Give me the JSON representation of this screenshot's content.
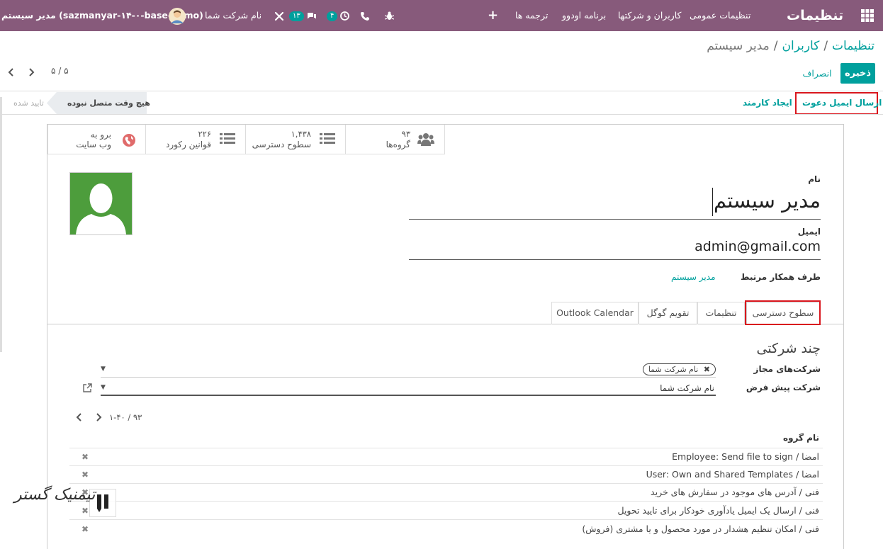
{
  "navbar": {
    "brand": "تنظیمات",
    "menu": [
      "تنظیمات عمومی",
      "کاربران و شرکتها",
      "برنامه اودوو",
      "ترجمه ها"
    ],
    "company": "نام شرکت شما",
    "chat_count": "۱۳",
    "activity_count": "۴",
    "user": "مدیر سیستم (sazmanyar-۱۴-۰-base-demo)"
  },
  "breadcrumb": {
    "root": "تنظیمات",
    "users": "کاربران",
    "current": "مدیر سیستم",
    "sep": "/"
  },
  "actions": {
    "save": "ذخیره",
    "discard": "انصراف"
  },
  "pager": {
    "value": "۵ / ۵"
  },
  "header": {
    "invite_button": "ارسال ایمیل دعوت",
    "create_employee_button": "ایجاد کارمند",
    "stage_never": "هیچ وقت متصل نبوده",
    "stage_confirmed": "تایید شده"
  },
  "smart_buttons": {
    "groups": {
      "count": "۹۳",
      "label": "گروه‌ها"
    },
    "access": {
      "count": "۱,۴۳۸",
      "label": "سطوح دسترسی"
    },
    "rules": {
      "count": "۲۲۶",
      "label": "قوانین رکورد"
    },
    "website": {
      "line1": "برو به",
      "line2": "وب سایت"
    }
  },
  "form": {
    "name_label": "نام",
    "name_value": "مدیر سیستم",
    "email_label": "ایمیل",
    "email_value": "admin@gmail.com",
    "partner_label": "طرف همکار مرتبط",
    "partner_value": "مدیر سیستم"
  },
  "tabs": [
    "سطوح دسترسی",
    "تنظیمات",
    "تقویم گوگل",
    "Outlook Calendar"
  ],
  "access": {
    "section_title": "چند شرکتی",
    "allowed_label": "شرکت‌های مجاز",
    "allowed_tag": "نام شرکت شما",
    "default_label": "شرکت پیش فرض",
    "default_value": "نام شرکت شما",
    "list_pager": "۱-۴۰ / ۹۳",
    "group_header": "نام گروه",
    "groups": [
      "امضا / Employee: Send file to sign",
      "امضا / User: Own and Shared Templates",
      "فنی / آدرس های موجود در سفارش های خرید",
      "فنی / ارسال یک ایمیل یادآوری خودکار برای تایید تحویل",
      "فنی / امکان تنظیم هشدار در مورد محصول و یا مشتری (فروش)"
    ]
  },
  "watermark": "تیمنیک گستر",
  "colors": {
    "navbar": "#875a7b",
    "accent": "#00a09d",
    "highlight": "#d9161d"
  }
}
